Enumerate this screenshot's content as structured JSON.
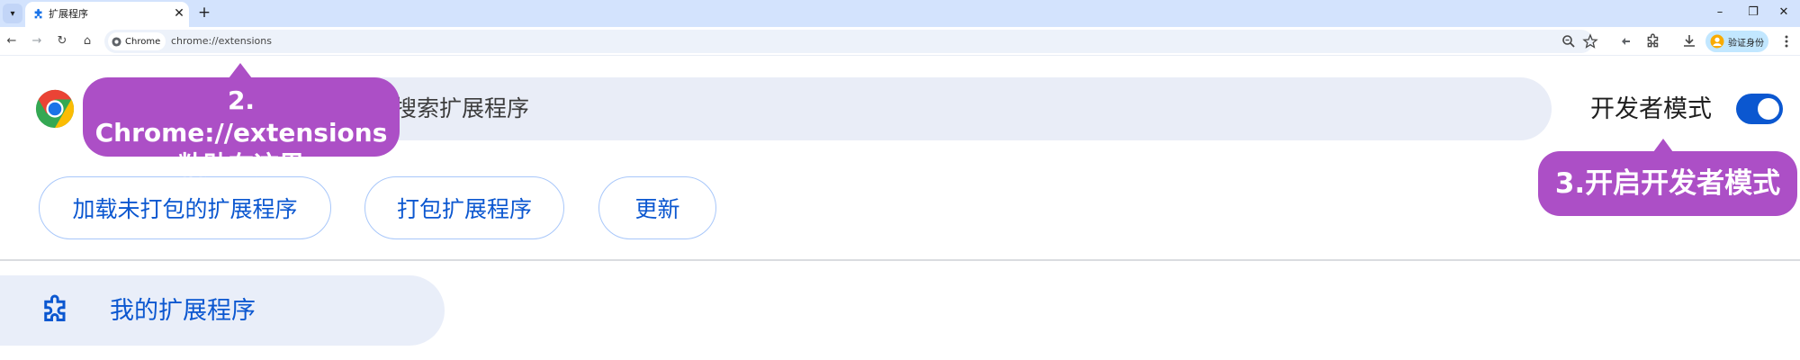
{
  "browser": {
    "tab_title": "扩展程序",
    "tab_close": "✕",
    "new_tab": "+",
    "window_controls": {
      "minimize": "–",
      "restore": "❐",
      "close": "✕"
    },
    "nav": {
      "back": "←",
      "forward": "→",
      "reload": "↻",
      "home": "⌂"
    },
    "site_chip_label": "Chrome",
    "url": "chrome://extensions",
    "profile_label": "验证身份"
  },
  "page": {
    "search_placeholder": "搜索扩展程序",
    "developer_mode_label": "开发者模式",
    "developer_mode_on": true,
    "buttons": {
      "load_unpacked": "加载未打包的扩展程序",
      "pack_extension": "打包扩展程序",
      "update": "更新"
    },
    "sidebar_item_label": "我的扩展程序"
  },
  "annotations": {
    "callout_2_line1": "2. Chrome://extensions",
    "callout_2_line2": "粘贴在这里",
    "callout_3": "3.开启开发者模式",
    "color": "#ac4fc6"
  },
  "colors": {
    "accent": "#0b57d0",
    "titlebar": "#d3e3fd",
    "search_bg": "#e9edf7"
  },
  "icons": {
    "tab_icon": "puzzle-icon",
    "zoom": "zoom-icon",
    "bookmark": "star-icon",
    "extensions": "puzzle-icon",
    "download": "download-icon",
    "menu": "kebab-menu-icon"
  }
}
